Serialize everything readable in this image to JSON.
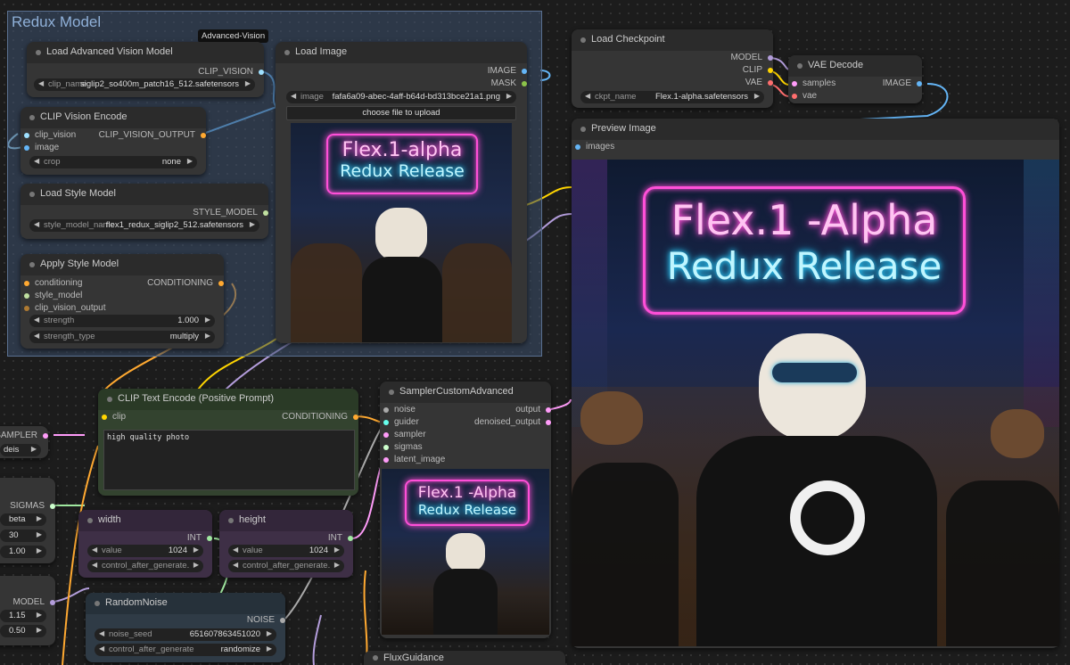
{
  "group": {
    "title": "Redux Model"
  },
  "reroute_tag": "Advanced-Vision",
  "load_advanced_vision_model": {
    "title": "Load Advanced Vision Model",
    "output": "CLIP_VISION",
    "clip_name_label": "clip_name",
    "clip_name_value": "siglip2_so400m_patch16_512.safetensors"
  },
  "clip_vision_encode": {
    "title": "CLIP Vision Encode",
    "input_clip_vision": "clip_vision",
    "input_image": "image",
    "output": "CLIP_VISION_OUTPUT",
    "crop_label": "crop",
    "crop_value": "none"
  },
  "load_style_model": {
    "title": "Load Style Model",
    "output": "STYLE_MODEL",
    "style_model_name_label": "style_model_name",
    "style_model_name_value": "flex1_redux_siglip2_512.safetensors"
  },
  "apply_style_model": {
    "title": "Apply Style Model",
    "input_conditioning": "conditioning",
    "input_style_model": "style_model",
    "input_clip_vision_output": "clip_vision_output",
    "output": "CONDITIONING",
    "strength_label": "strength",
    "strength_value": "1.000",
    "strength_type_label": "strength_type",
    "strength_type_value": "multiply"
  },
  "load_image": {
    "title": "Load Image",
    "output_image": "IMAGE",
    "output_mask": "MASK",
    "image_label": "image",
    "image_value": "fafa6a09-abec-4aff-b64d-bd313bce21a1.png",
    "upload_button": "choose file to upload"
  },
  "load_checkpoint": {
    "title": "Load Checkpoint",
    "output_model": "MODEL",
    "output_clip": "CLIP",
    "output_vae": "VAE",
    "ckpt_name_label": "ckpt_name",
    "ckpt_name_value": "Flex.1-alpha.safetensors"
  },
  "vae_decode": {
    "title": "VAE Decode",
    "input_samples": "samples",
    "input_vae": "vae",
    "output": "IMAGE"
  },
  "preview_image": {
    "title": "Preview Image",
    "input_images": "images"
  },
  "neon_sign": {
    "line1_small": "Flex.1-alpha",
    "line1_large": "Flex.1 -Alpha",
    "line2": "Redux Release"
  },
  "clip_text_encode": {
    "title": "CLIP Text Encode (Positive Prompt)",
    "input_clip": "clip",
    "output": "CONDITIONING",
    "prompt_text": "high quality photo"
  },
  "sampler_custom_advanced": {
    "title": "SamplerCustomAdvanced",
    "inputs": [
      "noise",
      "guider",
      "sampler",
      "sigmas",
      "latent_image"
    ],
    "output_output": "output",
    "output_denoised": "denoised_output"
  },
  "left_sampler": {
    "output": "SAMPLER",
    "value": "deis"
  },
  "left_sigmas": {
    "output": "SIGMAS",
    "scheduler": "beta",
    "steps": "30",
    "denoise": "1.00"
  },
  "left_model": {
    "output": "MODEL",
    "v1": "1.15",
    "v2": "0.50"
  },
  "width_node": {
    "title": "width",
    "output": "INT",
    "value_label": "value",
    "value": "1024",
    "control_label": "control_after_generate."
  },
  "height_node": {
    "title": "height",
    "output": "INT",
    "value_label": "value",
    "value": "1024",
    "control_label": "control_after_generate."
  },
  "random_noise": {
    "title": "RandomNoise",
    "output": "NOISE",
    "noise_seed_label": "noise_seed",
    "noise_seed_value": "651607863451020",
    "control_label": "control_after_generate",
    "control_value": "randomize"
  },
  "flux_guidance": {
    "title": "FluxGuidance"
  },
  "colors": {
    "clip_vision": "#9fe0ff",
    "image": "#64b5f6",
    "conditioning": "#ffa931",
    "style_model": "#c0e0a0",
    "model": "#b39ddb",
    "clip": "#ffd500",
    "vae": "#ff6e6e",
    "latent": "#ff9cf9",
    "int": "#a0e8a0",
    "noise": "#aaaaaa"
  }
}
